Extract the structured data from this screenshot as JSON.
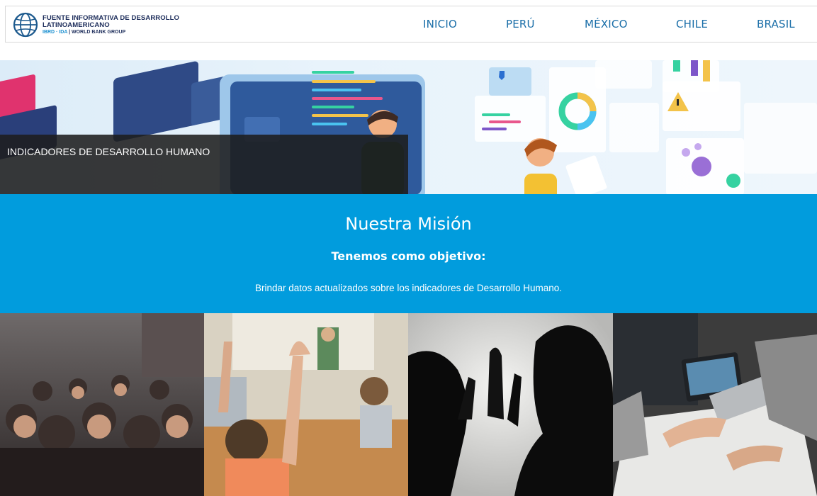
{
  "header": {
    "logo": {
      "line1": "FUENTE INFORMATIVA DE DESARROLLO",
      "line2": "LATINOAMERICANO",
      "sub_ibrd": "IBRD · IDA",
      "sub_wbg": "WORLD BANK GROUP"
    },
    "nav": [
      {
        "label": "INICIO"
      },
      {
        "label": "PERÚ"
      },
      {
        "label": "MÉXICO"
      },
      {
        "label": "CHILE"
      },
      {
        "label": "BRASIL"
      }
    ]
  },
  "hero": {
    "caption": "INDICADORES DE DESARROLLO HUMANO"
  },
  "mission": {
    "title": "Nuestra Misión",
    "subtitle": "Tenemos como objetivo:",
    "text": "Brindar datos actualizados sobre los indicadores de Desarrollo Humano."
  },
  "colors": {
    "brand_blue": "#019cdd",
    "nav_text": "#1a6ea8",
    "caption_bg": "#1e1e1e"
  },
  "photos": [
    {
      "subject": "crowd"
    },
    {
      "subject": "classroom"
    },
    {
      "subject": "silhouettes"
    },
    {
      "subject": "teamwork"
    }
  ]
}
